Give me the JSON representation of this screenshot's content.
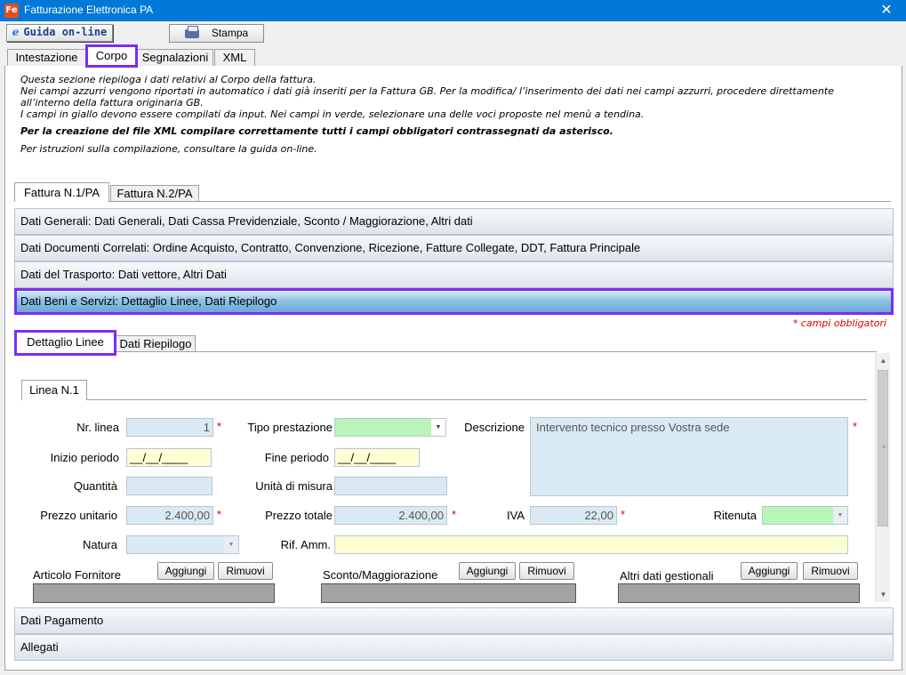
{
  "window": {
    "title": "Fatturazione Elettronica PA",
    "app_icon": "Fe",
    "close": "✕"
  },
  "toolbar": {
    "help_label": "Guida on-line",
    "help_icon": "e",
    "print_label": "Stampa"
  },
  "main_tabs": [
    "Intestazione",
    "Corpo",
    "Segnalazioni",
    "XML"
  ],
  "info": {
    "line1": "Questa sezione riepiloga i dati relativi al Corpo della fattura.",
    "line2": "Nei campi azzurri vengono riportati in automatico i dati già inseriti per la Fattura GB. Per la modifica/ l’inserimento dei dati nei campi azzurri, procedere direttamente all’interno della fattura originaria GB.",
    "line3": "I campi in giallo devono essere compilati da input. Nei campi in verde, selezionare una delle voci proposte nel menù a tendina.",
    "bold": "Per la creazione del file XML compilare correttamente tutti i campi obbligatori contrassegnati da asterisco.",
    "last": "Per istruzioni sulla compilazione, consultare la guida on-line."
  },
  "invoice_tabs": [
    "Fattura N.1/PA",
    "Fattura N.2/PA"
  ],
  "sections": {
    "s1": "Dati Generali: Dati Generali, Dati Cassa Previdenziale, Sconto / Maggiorazione, Altri dati",
    "s2": "Dati Documenti Correlati: Ordine Acquisto, Contratto, Convenzione, Ricezione, Fatture Collegate, DDT, Fattura Principale",
    "s3": "Dati del Trasporto: Dati vettore, Altri Dati",
    "s4": "Dati Beni e Servizi: Dettaglio Linee, Dati Riepilogo",
    "s5": "Dati Pagamento",
    "s6": "Allegati"
  },
  "required_note": "* campi obbligatori",
  "detail_tabs": [
    "Dettaglio Linee",
    "Dati Riepilogo"
  ],
  "line_tab": "Linea N.1",
  "form": {
    "nr_linea_label": "Nr. linea",
    "nr_linea_value": "1",
    "tipo_label": "Tipo prestazione",
    "tipo_value": "",
    "descrizione_label": "Descrizione",
    "descrizione_value": "Intervento tecnico presso Vostra sede",
    "inizio_label": "Inizio periodo",
    "inizio_value": "__/__/____",
    "fine_label": "Fine periodo",
    "fine_value": "__/__/____",
    "quantita_label": "Quantità",
    "quantita_value": "",
    "unita_label": "Unità di misura",
    "unita_value": "",
    "prezzo_unit_label": "Prezzo unitario",
    "prezzo_unit_value": "2.400,00",
    "prezzo_tot_label": "Prezzo totale",
    "prezzo_tot_value": "2.400,00",
    "iva_label": "IVA",
    "iva_value": "22,00",
    "ritenuta_label": "Ritenuta",
    "ritenuta_value": "",
    "natura_label": "Natura",
    "natura_value": "",
    "rif_label": "Rif. Amm.",
    "rif_value": "",
    "star": "*"
  },
  "subtables": {
    "articolo": "Articolo Fornitore",
    "sconto": "Sconto/Maggiorazione",
    "altri": "Altri dati gestionali",
    "add": "Aggiungi",
    "remove": "Rimuovi"
  },
  "colors": {
    "titlebar": "#0078d7",
    "highlight": "#7a2ef0",
    "required": "#d00000",
    "field_blue": "#daeaf5",
    "field_yellow": "#fefed3",
    "field_green": "#b9f5b9"
  }
}
